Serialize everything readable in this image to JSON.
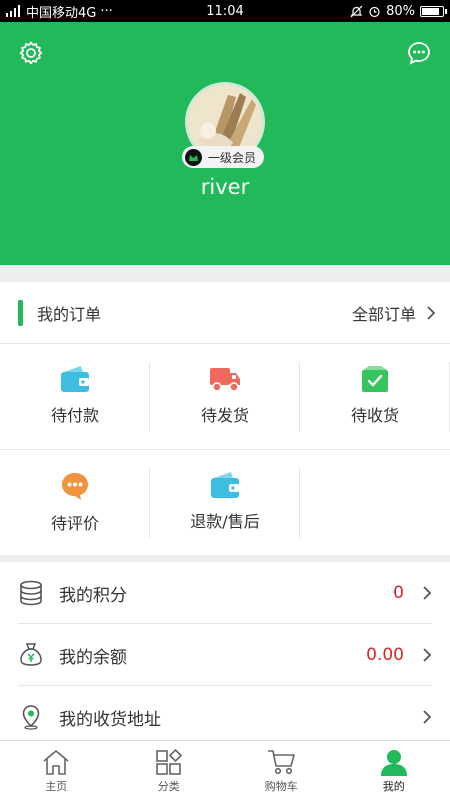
{
  "status_bar": {
    "carrier": "中国移动4G",
    "dots": "···",
    "time": "11:04",
    "battery": "80%",
    "battery_level": 0.8
  },
  "profile": {
    "member_level": "一级会员",
    "username": "river"
  },
  "orders": {
    "title": "我的订单",
    "all_link": "全部订单",
    "items": [
      {
        "label": "待付款",
        "icon": "wallet-icon",
        "color": "#3dbde0"
      },
      {
        "label": "待发货",
        "icon": "truck-icon",
        "color": "#f06a5c"
      },
      {
        "label": "待收货",
        "icon": "checked-box-icon",
        "color": "#37c45f"
      },
      {
        "label": "待评价",
        "icon": "chat-bubble-icon",
        "color": "#f0923e"
      },
      {
        "label": "退款/售后",
        "icon": "wallet-icon",
        "color": "#3dbde0"
      }
    ]
  },
  "account": {
    "items": [
      {
        "label": "我的积分",
        "value": "0",
        "icon": "database-icon"
      },
      {
        "label": "我的余额",
        "value": "0.00",
        "icon": "money-bag-icon"
      },
      {
        "label": "我的收货地址",
        "value": "",
        "icon": "location-pin-icon"
      }
    ]
  },
  "tabbar": {
    "items": [
      {
        "label": "主页",
        "icon": "home-icon",
        "active": false
      },
      {
        "label": "分类",
        "icon": "category-grid-icon",
        "active": false
      },
      {
        "label": "购物车",
        "icon": "cart-icon",
        "active": false
      },
      {
        "label": "我的",
        "icon": "user-icon",
        "active": true
      }
    ]
  },
  "colors": {
    "brand_green": "#21b95a",
    "value_red": "#d9262a"
  }
}
